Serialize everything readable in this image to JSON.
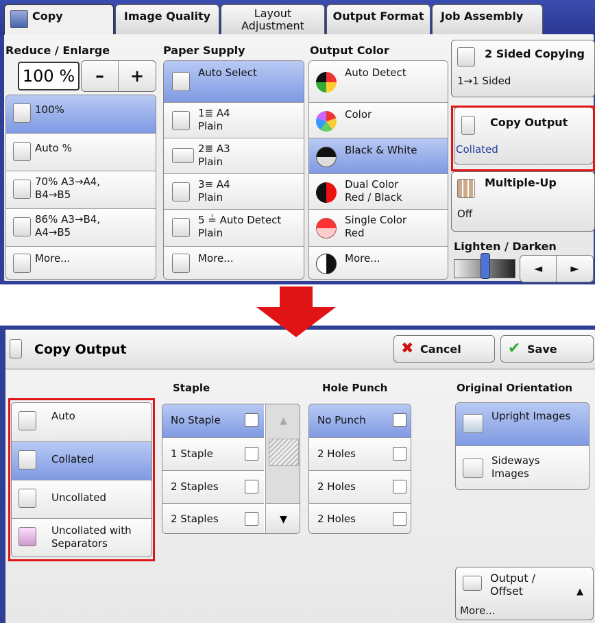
{
  "tabs": [
    "Copy",
    "Image Quality",
    "Layout\nAdjustment",
    "Output Format",
    "Job Assembly"
  ],
  "reduce_enlarge": {
    "header": "Reduce / Enlarge",
    "value": "100 %",
    "minus": "–",
    "plus": "+",
    "items": [
      {
        "l1": "100%",
        "l2": ""
      },
      {
        "l1": "Auto %",
        "l2": ""
      },
      {
        "l1": "70% A3→A4,",
        "l2": "B4→B5"
      },
      {
        "l1": "86% A3→B4,",
        "l2": "A4→B5"
      },
      {
        "l1": "More...",
        "l2": ""
      }
    ]
  },
  "paper_supply": {
    "header": "Paper Supply",
    "items": [
      {
        "l1": "Auto Select",
        "l2": ""
      },
      {
        "l1": "1≣ A4",
        "l2": "Plain"
      },
      {
        "l1": "2≣ A3",
        "l2": "Plain"
      },
      {
        "l1": "3≡ A4",
        "l2": "Plain"
      },
      {
        "l1": "5 ≟ Auto Detect",
        "l2": "Plain"
      },
      {
        "l1": "More...",
        "l2": ""
      }
    ]
  },
  "output_color": {
    "header": "Output Color",
    "items": [
      {
        "l1": "Auto Detect",
        "l2": ""
      },
      {
        "l1": "Color",
        "l2": ""
      },
      {
        "l1": "Black & White",
        "l2": ""
      },
      {
        "l1": "Dual Color",
        "l2": "Red / Black"
      },
      {
        "l1": "Single Color",
        "l2": "Red"
      },
      {
        "l1": "More...",
        "l2": ""
      }
    ]
  },
  "right": {
    "two_sided_title": "2 Sided Copying",
    "two_sided_value": "1→1 Sided",
    "copy_output_title": "Copy Output",
    "copy_output_value": "Collated",
    "multiple_up_title": "Multiple-Up",
    "multiple_up_value": "Off",
    "lighten_label": "Lighten / Darken",
    "left_arrow": "◄",
    "right_arrow": "►"
  },
  "dialog": {
    "title": "Copy Output",
    "cancel": "Cancel",
    "save": "Save",
    "collation": [
      "Auto",
      "Collated",
      "Uncollated",
      "Uncollated with\nSeparators"
    ],
    "staple": {
      "header": "Staple",
      "items": [
        "No Staple",
        "1 Staple",
        "2 Staples",
        "2 Staples"
      ]
    },
    "hole": {
      "header": "Hole Punch",
      "items": [
        "No Punch",
        "2 Holes",
        "2 Holes",
        "2 Holes"
      ]
    },
    "orientation": {
      "header": "Original Orientation",
      "items": [
        "Upright Images",
        "Sideways\nImages"
      ]
    },
    "output_offset": "Output /\nOffset",
    "output_more": "More...",
    "up_arrow": "▲",
    "down_arrow": "▼",
    "scroll_up": "▲"
  },
  "colors": {
    "accent_red": "#e01414",
    "select_blue": "#8aa3e6",
    "frame": "#2f3f96"
  }
}
